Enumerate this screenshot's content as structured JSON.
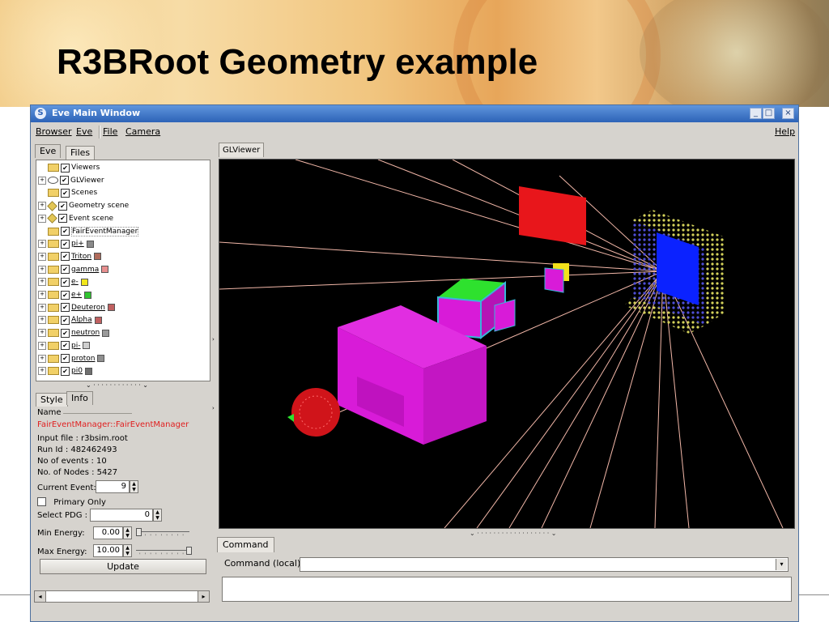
{
  "slide": {
    "title": "R3BRoot Geometry example"
  },
  "window": {
    "title": "Eve Main Window",
    "controls": [
      "_",
      "□",
      "×"
    ]
  },
  "menu": {
    "items": [
      "Browser",
      "Eve",
      "File",
      "Camera"
    ],
    "help": "Help"
  },
  "left_tabs": [
    "Eve",
    "Files"
  ],
  "tree": {
    "rows": [
      {
        "label": "Viewers",
        "icon": "folder-icon",
        "expander": false,
        "checked": true
      },
      {
        "label": "GLViewer",
        "icon": "eye-icon",
        "expander": true,
        "checked": true
      },
      {
        "label": "Scenes",
        "icon": "folder-icon",
        "expander": false,
        "checked": true
      },
      {
        "label": "Geometry scene",
        "icon": "cube-icon",
        "expander": true,
        "checked": true
      },
      {
        "label": "Event scene",
        "icon": "cube-icon",
        "expander": true,
        "checked": true
      },
      {
        "label": "FairEventManager",
        "icon": "folder-icon",
        "expander": false,
        "checked": true,
        "selected": true
      },
      {
        "label": "pi+",
        "icon": "folder-icon",
        "expander": true,
        "checked": true,
        "color": "#8a8a8a"
      },
      {
        "label": "Triton",
        "icon": "folder-icon",
        "expander": true,
        "checked": true,
        "color": "#b06a5a"
      },
      {
        "label": "gamma",
        "icon": "folder-icon",
        "expander": true,
        "checked": true,
        "color": "#e88f8f"
      },
      {
        "label": "e-",
        "icon": "folder-icon",
        "expander": true,
        "checked": true,
        "color": "#f2e71c"
      },
      {
        "label": "e+",
        "icon": "folder-icon",
        "expander": true,
        "checked": true,
        "color": "#31c431"
      },
      {
        "label": "Deuteron",
        "icon": "folder-icon",
        "expander": true,
        "checked": true,
        "color": "#c06060"
      },
      {
        "label": "Alpha",
        "icon": "folder-icon",
        "expander": true,
        "checked": true,
        "color": "#c06060"
      },
      {
        "label": "neutron",
        "icon": "folder-icon",
        "expander": true,
        "checked": true,
        "color": "#9a9a9a"
      },
      {
        "label": "pi-",
        "icon": "folder-icon",
        "expander": true,
        "checked": true,
        "color": "#cfcfcf"
      },
      {
        "label": "proton",
        "icon": "folder-icon",
        "expander": true,
        "checked": true,
        "color": "#8f8f8f"
      },
      {
        "label": "pi0",
        "icon": "folder-icon",
        "expander": true,
        "checked": true,
        "color": "#6f6f6f"
      }
    ]
  },
  "editor_tabs": [
    "Style",
    "Info"
  ],
  "info": {
    "name_label": "Name",
    "name_value": "FairEventManager::FairEventManager",
    "lines": [
      "Input file : r3bsim.root",
      "Run Id : 482462493",
      "No of events : 10",
      "No. of Nodes : 5427"
    ],
    "current_event_label": "Current Event:",
    "current_event_value": "9",
    "primary_only_label": "Primary Only",
    "select_pdg_label": "Select PDG :",
    "select_pdg_value": "0",
    "min_energy_label": "Min Energy:",
    "min_energy_value": "0.00",
    "min_energy_slider": 0.0,
    "max_energy_label": "Max Energy:",
    "max_energy_value": "10.00",
    "max_energy_slider": 1.0,
    "update_label": "Update"
  },
  "gl": {
    "tab_label": "GLViewer"
  },
  "command": {
    "tab_label": "Command",
    "label": "Command (local):",
    "value": ""
  },
  "colors": {
    "titlebar": "#3a70c4",
    "magenta": "#d81bd8",
    "red": "#e8161b",
    "blue": "#0b22ff",
    "green": "#2ee12e",
    "track": "#f2b7a8"
  }
}
